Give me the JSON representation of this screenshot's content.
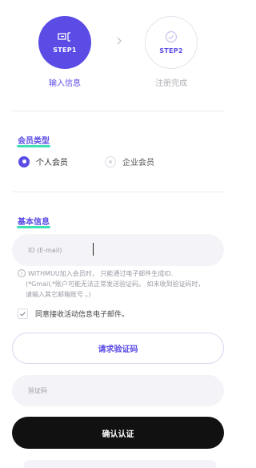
{
  "steps": {
    "step1": {
      "label": "STEP1",
      "caption": "输入信息",
      "icon": "card-icon"
    },
    "step2": {
      "label": "STEP2",
      "caption": "注册完成",
      "icon": "check-circle-icon"
    }
  },
  "member_type": {
    "title": "会员类型",
    "options": [
      {
        "label": "个人会员",
        "selected": true
      },
      {
        "label": "企业会员",
        "selected": false
      }
    ]
  },
  "basic_info": {
    "title": "基本信息",
    "id_field": {
      "placeholder": "ID (E-mail)",
      "value": ""
    },
    "notes": {
      "line1": "WITHMUU加入会员时， 只能通过电子邮件生成ID.",
      "line2": "(*Gmail,*账户可能无法正常发送验证码。 如未收到验证码时，",
      "line3": "请输入其它邮箱账号 。)"
    },
    "consent_label": "同意接收活动信息电子邮件。",
    "request_code_button": "请求验证码",
    "code_field": {
      "placeholder": "验证码",
      "value": ""
    },
    "confirm_button": "确认认证"
  },
  "colors": {
    "accent": "#5b4ce6",
    "highlight": "#3fe0b4",
    "dark": "#111111"
  }
}
